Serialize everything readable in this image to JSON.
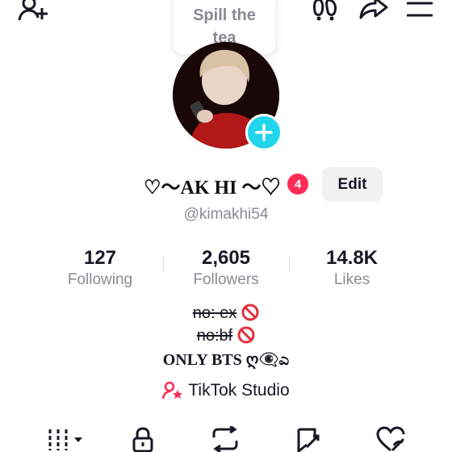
{
  "topbar": {
    "icons": [
      "add-friend-icon",
      "footprints-icon",
      "share-icon",
      "menu-icon"
    ]
  },
  "bubble": {
    "line1": "Spill the",
    "line2": "tea"
  },
  "profile": {
    "display_name": "♡〜AK HI 〜♡",
    "notification_count": "4",
    "edit_label": "Edit",
    "handle": "@kimakhi54"
  },
  "stats": [
    {
      "value": "127",
      "label": "Following"
    },
    {
      "value": "2,605",
      "label": "Followers"
    },
    {
      "value": "14.8K",
      "label": "Likes"
    }
  ],
  "bio": {
    "line1_struck": "no: ex",
    "line2_struck": "no:bf",
    "line3": "ONLY BTS ღ👁‍🗨ಎ"
  },
  "studio": {
    "label": "TikTok Studio"
  },
  "tabs": [
    "videos-grid-icon",
    "private-lock-icon",
    "reposts-icon",
    "favorites-icon",
    "liked-icon"
  ],
  "colors": {
    "accent": "#fe2c55",
    "plus": "#20d5ec",
    "muted": "#8a8b91"
  }
}
